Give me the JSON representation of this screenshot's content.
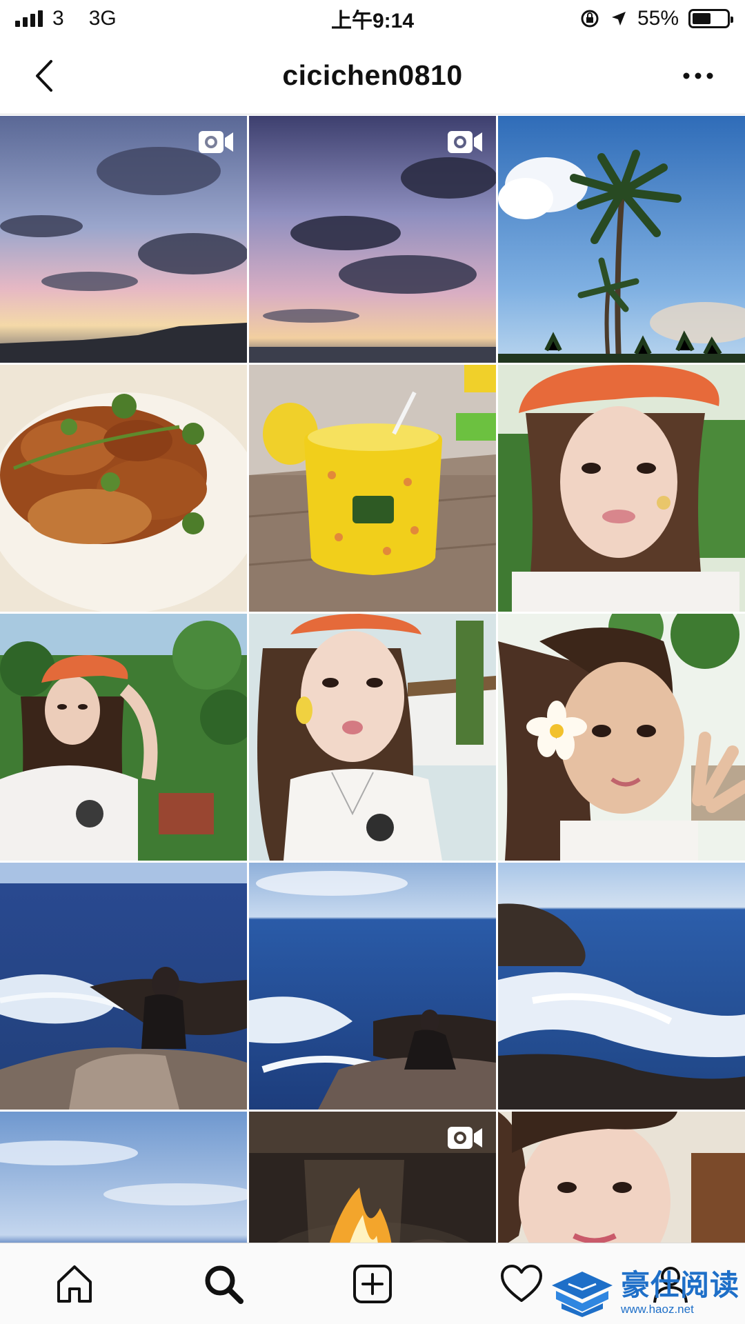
{
  "status_bar": {
    "carrier": "3",
    "network": "3G",
    "time": "上午9:14",
    "battery_percent": "55%",
    "battery_level": 0.55
  },
  "header": {
    "username": "cicichen0810",
    "back_icon": "chevron-left-icon",
    "more_icon": "more-dots-icon"
  },
  "grid": {
    "posts": [
      {
        "subject": "sunset sky with clouds",
        "is_video": true
      },
      {
        "subject": "purple sunset clouds",
        "is_video": true
      },
      {
        "subject": "palm trees blue sky",
        "is_video": false
      },
      {
        "subject": "fried shrimp dish",
        "is_video": false
      },
      {
        "subject": "pineapple cup drink",
        "is_video": false
      },
      {
        "subject": "selfie orange cap",
        "is_video": false
      },
      {
        "subject": "woman orange cap garden",
        "is_video": false
      },
      {
        "subject": "selfie white shirt",
        "is_video": false
      },
      {
        "subject": "selfie plumeria flower",
        "is_video": false
      },
      {
        "subject": "woman sitting on rocks by ocean",
        "is_video": false
      },
      {
        "subject": "woman on rocks ocean waves",
        "is_video": false
      },
      {
        "subject": "cliff and ocean waves",
        "is_video": false
      },
      {
        "subject": "ocean horizon sky",
        "is_video": false
      },
      {
        "subject": "fire pit glass",
        "is_video": true
      },
      {
        "subject": "selfie with shaved ice",
        "is_video": false
      }
    ]
  },
  "tabbar": {
    "tabs": [
      {
        "icon": "home-icon"
      },
      {
        "icon": "search-icon",
        "active": true
      },
      {
        "icon": "add-post-icon"
      },
      {
        "icon": "heart-icon"
      },
      {
        "icon": "profile-icon"
      }
    ]
  },
  "watermark": {
    "title": "豪仕阅读",
    "url": "www.haoz.net"
  },
  "colors": {
    "accent": "#1e6fc8",
    "divider": "#dbdbdb",
    "tabbar_bg": "#fafafa"
  }
}
